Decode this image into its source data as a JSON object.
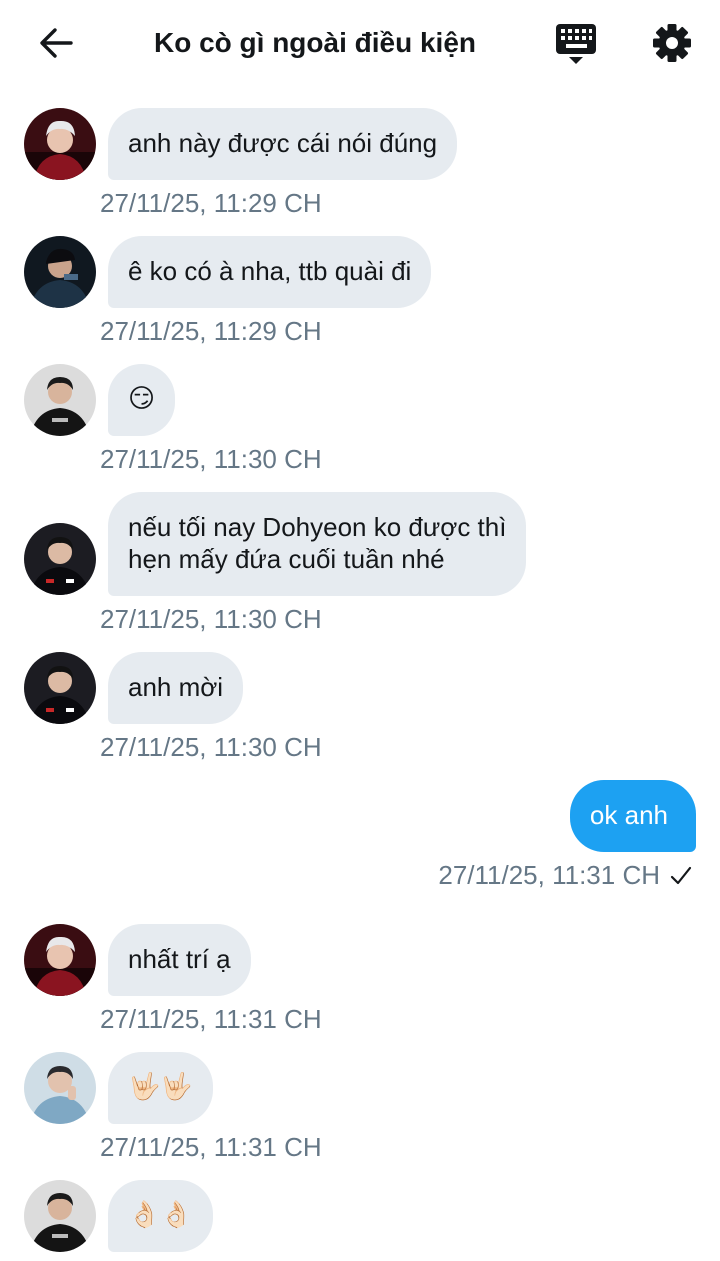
{
  "header": {
    "title": "Ko cò gì ngoài điều kiện",
    "back_icon": "arrow-left-icon",
    "keyboard_icon": "keyboard-icon",
    "settings_icon": "gear-icon"
  },
  "colors": {
    "incoming_bubble": "#e6ebf0",
    "outgoing_bubble": "#1da1f2",
    "timestamp": "#657786",
    "text": "#14171a"
  },
  "messages": [
    {
      "direction": "in",
      "avatar": "avatar-red-jersey-blond",
      "text": "anh này được cái nói đúng",
      "time": "27/11/25, 11:29 CH"
    },
    {
      "direction": "in",
      "avatar": "avatar-dark-jersey-cap",
      "text": "ê ko có à nha, ttb quài đi",
      "time": "27/11/25, 11:29 CH"
    },
    {
      "direction": "in",
      "avatar": "avatar-black-shirt",
      "text": "😏",
      "time": "27/11/25, 11:30 CH"
    },
    {
      "direction": "in",
      "avatar": "avatar-black-jersey",
      "text_lines": [
        "nếu tối nay Dohyeon ko được thì",
        "hẹn mấy đứa cuối tuần nhé"
      ],
      "time": "27/11/25, 11:30 CH"
    },
    {
      "direction": "in",
      "avatar": "avatar-black-jersey",
      "text": "anh mời",
      "time": "27/11/25, 11:30 CH"
    },
    {
      "direction": "out",
      "text": "ok anh",
      "time": "27/11/25, 11:31 CH",
      "status_icon": "check-icon"
    },
    {
      "direction": "in",
      "avatar": "avatar-red-jersey-blond",
      "text": "nhất trí ạ",
      "time": "27/11/25, 11:31 CH"
    },
    {
      "direction": "in",
      "avatar": "avatar-blue-hoodie",
      "text": "🤟🏻🤟🏻",
      "time": "27/11/25, 11:31 CH"
    },
    {
      "direction": "in",
      "avatar": "avatar-black-shirt",
      "text": "👌🏻👌🏻"
    }
  ]
}
